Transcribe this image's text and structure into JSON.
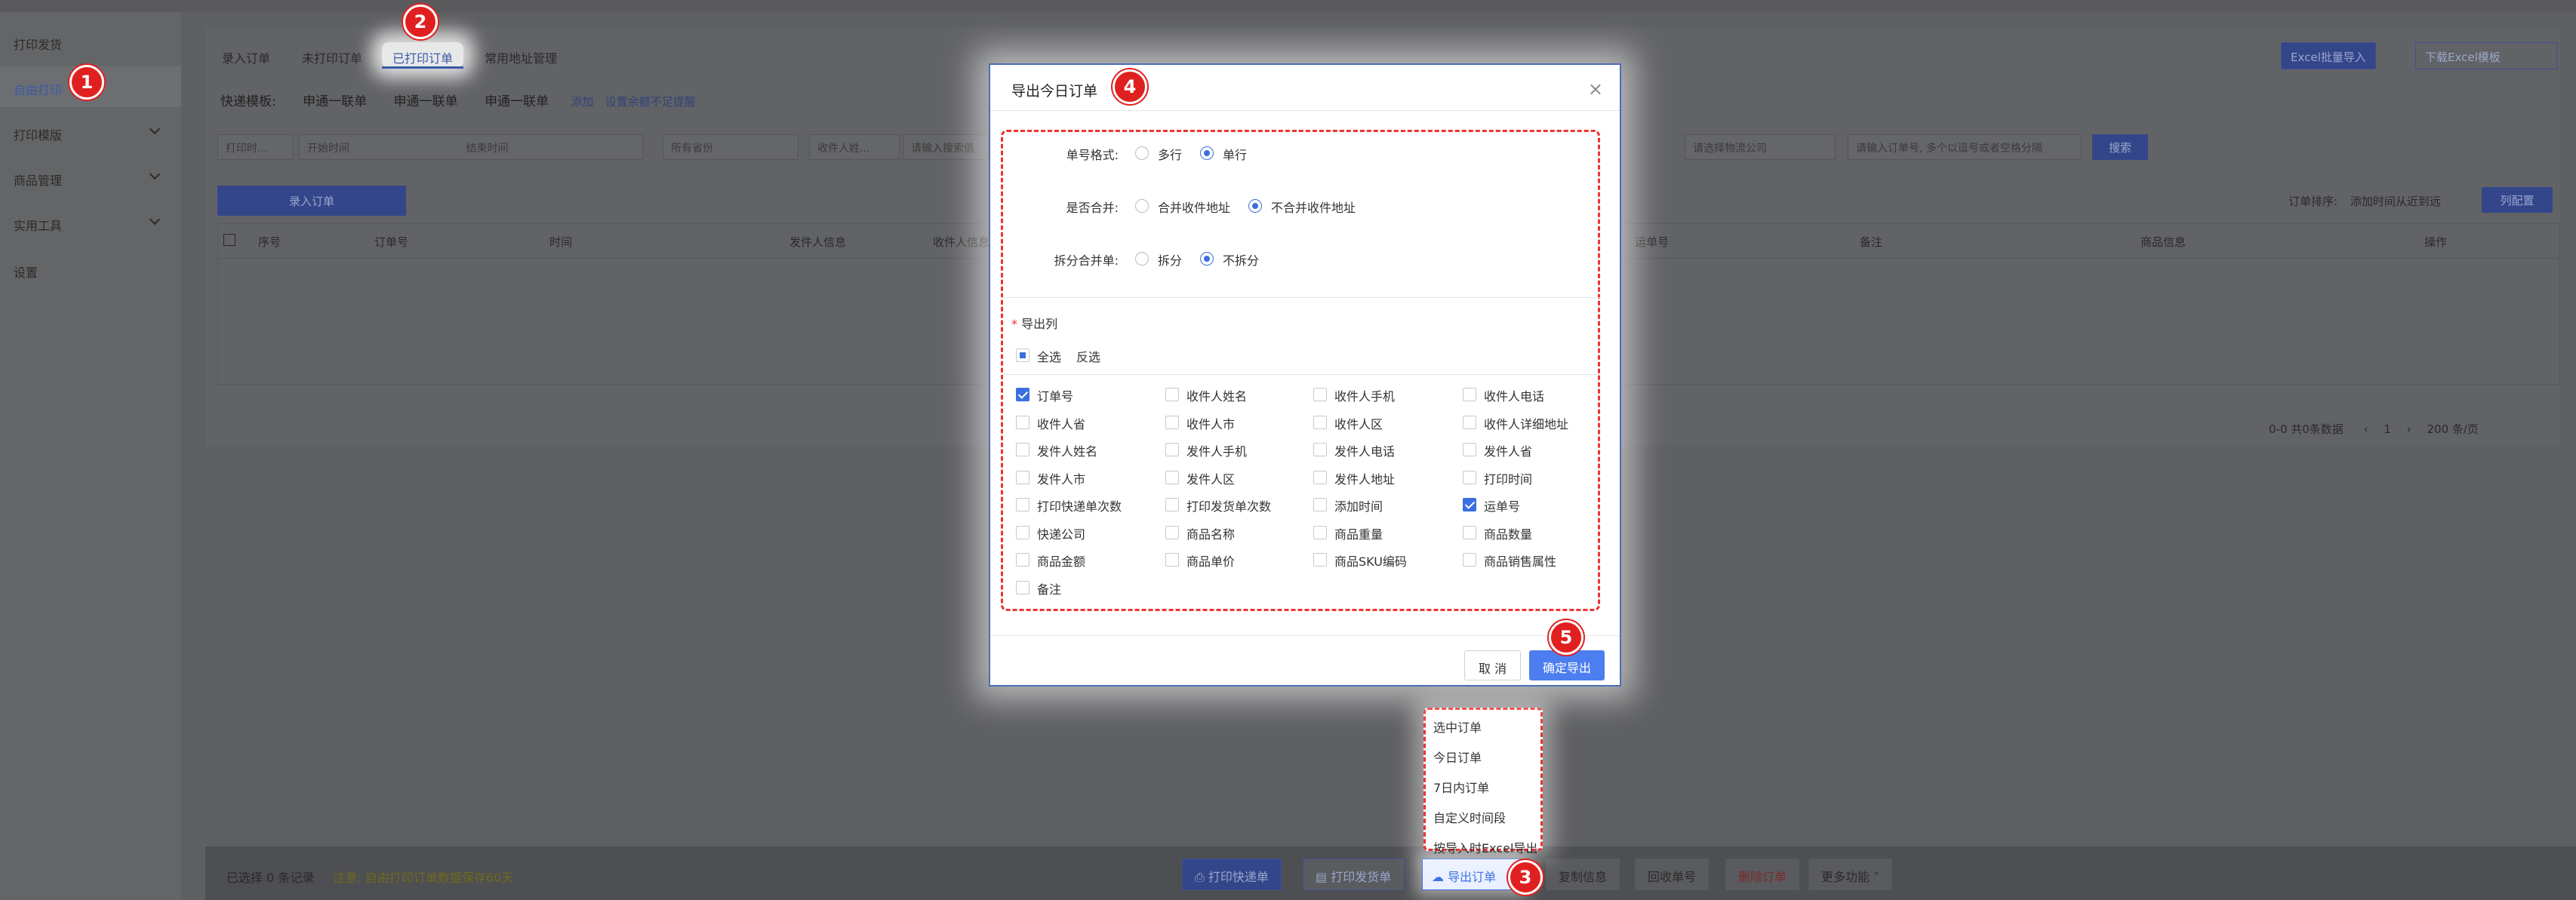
{
  "sidebar": {
    "items": [
      {
        "label": "打印发货"
      },
      {
        "label": "自由打印"
      },
      {
        "label": "打印模版"
      },
      {
        "label": "商品管理"
      },
      {
        "label": "实用工具"
      },
      {
        "label": "设置"
      }
    ]
  },
  "tabs": [
    {
      "label": "录入订单"
    },
    {
      "label": "未打印订单"
    },
    {
      "label": "已打印订单"
    },
    {
      "label": "常用地址管理"
    }
  ],
  "header_buttons": {
    "excel_import": "Excel批量导入",
    "download_template": "下载Excel模板"
  },
  "template_row": {
    "label": "快递模板:",
    "t1": "申通一联单",
    "t2": "申通一联单",
    "t3": "申通一联单",
    "add": "添加",
    "setting": "设置余额不足提醒"
  },
  "filters": {
    "print_time": "打印时...",
    "start": "开始时间",
    "end": "结束时间",
    "province": "所有省份",
    "receiver": "收件人姓...",
    "search_placeholder": "请输入搜索值",
    "logistics": "请选择物流公司",
    "order_placeholder": "请输入订单号, 多个以逗号或者空格分隔",
    "search_btn": "搜索"
  },
  "entry_button": "录入订单",
  "sort": {
    "label": "订单排序:",
    "value": "添加时间从近到远",
    "config": "列配置"
  },
  "table_headers": [
    "序号",
    "订单号",
    "时间",
    "发件人信息",
    "收件人信息",
    "运单号",
    "备注",
    "商品信息",
    "操作"
  ],
  "pagination": {
    "summary": "0-0 共0条数据",
    "page": "1",
    "size": "200 条/页"
  },
  "footer": {
    "selected": "已选择 0 条记录",
    "notice": "注意: 自由打印订单数据保存60天",
    "print_express": "打印快递单",
    "print_ship": "打印发货单",
    "export": "导出订单",
    "copy": "复制信息",
    "recycle": "回收单号",
    "delete": "删除订单",
    "more": "更多功能"
  },
  "dropdown": {
    "items": [
      "选中订单",
      "今日订单",
      "7日内订单",
      "自定义时间段",
      "按导入时Excel导出"
    ]
  },
  "modal": {
    "title": "导出今日订单",
    "close": "×",
    "format": {
      "label": "单号格式:",
      "opt1": "多行",
      "opt2": "单行",
      "selected": "单行"
    },
    "merge": {
      "label": "是否合并:",
      "opt1": "合并收件地址",
      "opt2": "不合并收件地址",
      "selected": "不合并收件地址"
    },
    "split": {
      "label": "拆分合并单:",
      "opt1": "拆分",
      "opt2": "不拆分",
      "selected": "不拆分"
    },
    "columns_label": "导出列",
    "required_mark": "*",
    "select_all": "全选",
    "invert": "反选",
    "columns": [
      {
        "label": "订单号",
        "checked": true
      },
      {
        "label": "收件人姓名",
        "checked": false
      },
      {
        "label": "收件人手机",
        "checked": false
      },
      {
        "label": "收件人电话",
        "checked": false
      },
      {
        "label": "收件人省",
        "checked": false
      },
      {
        "label": "收件人市",
        "checked": false
      },
      {
        "label": "收件人区",
        "checked": false
      },
      {
        "label": "收件人详细地址",
        "checked": false
      },
      {
        "label": "发件人姓名",
        "checked": false
      },
      {
        "label": "发件人手机",
        "checked": false
      },
      {
        "label": "发件人电话",
        "checked": false
      },
      {
        "label": "发件人省",
        "checked": false
      },
      {
        "label": "发件人市",
        "checked": false
      },
      {
        "label": "发件人区",
        "checked": false
      },
      {
        "label": "发件人地址",
        "checked": false
      },
      {
        "label": "打印时间",
        "checked": false
      },
      {
        "label": "打印快递单次数",
        "checked": false
      },
      {
        "label": "打印发货单次数",
        "checked": false
      },
      {
        "label": "添加时间",
        "checked": false
      },
      {
        "label": "运单号",
        "checked": true
      },
      {
        "label": "快递公司",
        "checked": false
      },
      {
        "label": "商品名称",
        "checked": false
      },
      {
        "label": "商品重量",
        "checked": false
      },
      {
        "label": "商品数量",
        "checked": false
      },
      {
        "label": "商品金额",
        "checked": false
      },
      {
        "label": "商品单价",
        "checked": false
      },
      {
        "label": "商品SKU编码",
        "checked": false
      },
      {
        "label": "商品销售属性",
        "checked": false
      },
      {
        "label": "备注",
        "checked": false
      }
    ],
    "cancel": "取 消",
    "confirm": "确定导出"
  },
  "badges": [
    "1",
    "2",
    "3",
    "4",
    "5"
  ],
  "colors": {
    "primary": "#3b6fe0",
    "annotation": "#e02020"
  }
}
